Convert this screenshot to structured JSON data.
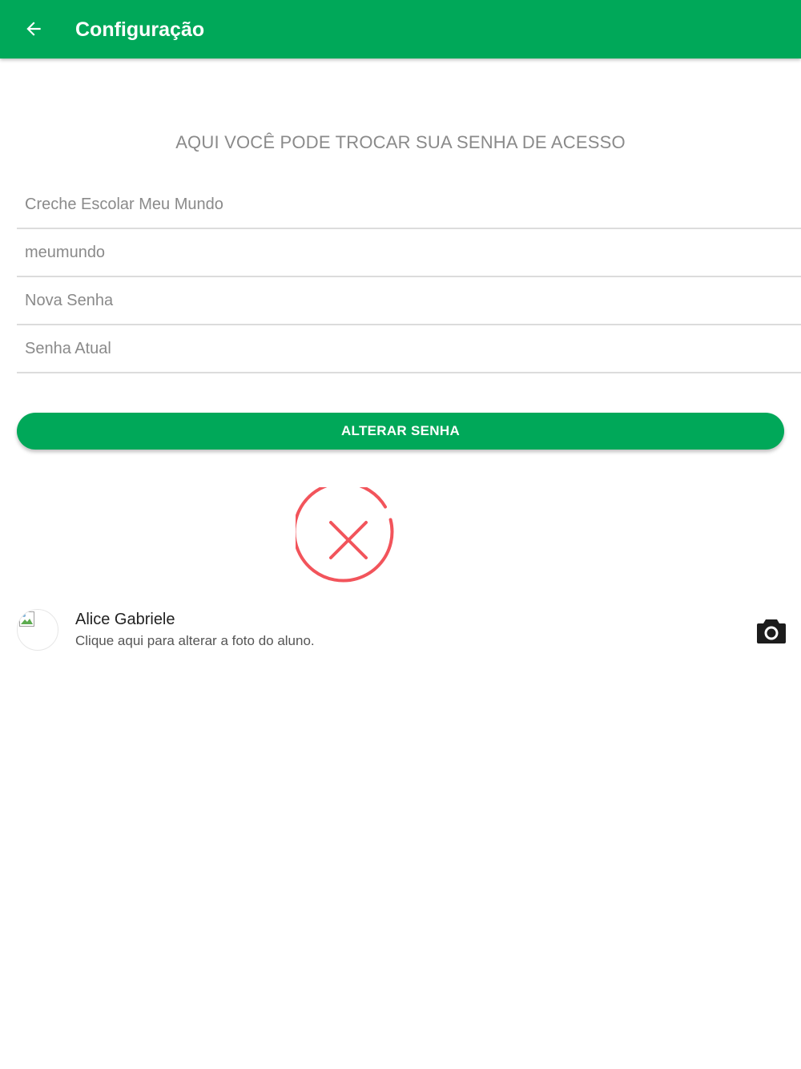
{
  "appbar": {
    "title": "Configuração",
    "back_icon": "arrow-left-icon",
    "color": "#00a859"
  },
  "main": {
    "subtitle": "AQUI VOCÊ PODE TROCAR SUA SENHA DE ACESSO",
    "fields": {
      "school": {
        "value": "",
        "placeholder": "Creche Escolar Meu Mundo"
      },
      "username": {
        "value": "",
        "placeholder": "meumundo"
      },
      "new_password": {
        "value": "",
        "placeholder": "Nova Senha"
      },
      "current_password": {
        "value": "",
        "placeholder": "Senha Atual"
      }
    },
    "submit_label": "ALTERAR SENHA",
    "status_icon": "error-x-circle-icon",
    "status_color": "#f2545b"
  },
  "student": {
    "name": "Alice Gabriele",
    "hint": "Clique aqui para alterar a foto do aluno.",
    "avatar_icon": "broken-image-icon",
    "action_icon": "camera-icon"
  }
}
